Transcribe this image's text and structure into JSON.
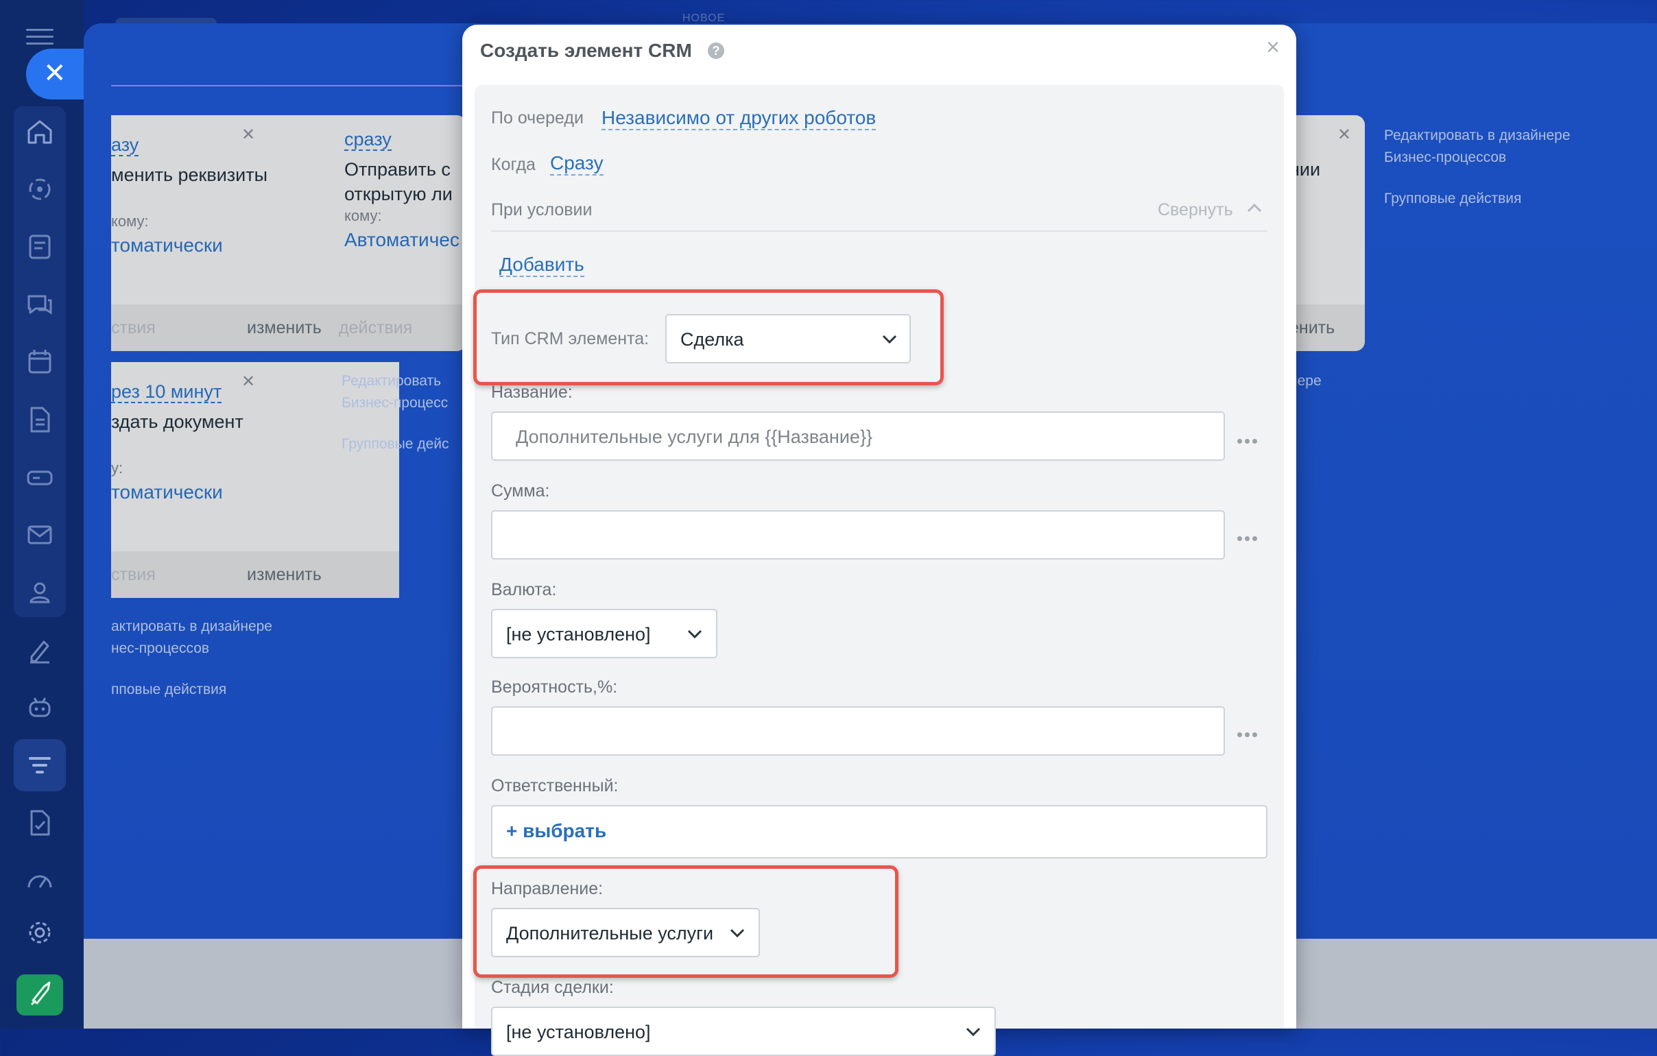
{
  "nav": {
    "icons": [
      "home-icon",
      "target-icon",
      "feed-icon",
      "chat-icon",
      "calendar-icon",
      "document-icon",
      "drive-icon",
      "mail-icon",
      "contacts-icon",
      "sign-icon",
      "bot-icon",
      "crm-funnel-icon",
      "task-doc-icon",
      "speedometer-icon",
      "gear-icon",
      "rocket-icon"
    ]
  },
  "background": {
    "top_label": "НОВОЕ",
    "card1": {
      "trigger": "азу",
      "action": "менить реквизиты",
      "to_label": "кому:",
      "to_value": "томатически",
      "foot_left": "ствия",
      "foot_right": "изменить"
    },
    "card2": {
      "trigger": "сразу",
      "action_line1": "Отправить с",
      "action_line2": "открытую ли",
      "to_label": "кому:",
      "to_value": "Автоматичес",
      "foot_left": "действия"
    },
    "card3": {
      "trigger": "рез 10 минут",
      "action": "здать документ",
      "to_label": "у:",
      "to_value": "томатически",
      "foot_left": "ствия",
      "foot_right": "изменить"
    },
    "card4": {
      "action": "нии",
      "foot_right": "енить"
    },
    "left_links": [
      "актировать в дизайнере",
      "нес-процессов",
      "пповые действия"
    ],
    "mid_links": [
      "Редактировать",
      "Бизнес-процесс",
      "Групповые дейс"
    ],
    "right_links": [
      "Редактировать в дизайнере",
      "Бизнес-процессов",
      "Групповые действия"
    ],
    "right_partial": "нере"
  },
  "modal": {
    "title": "Создать элемент CRM",
    "help": "?",
    "close": "×",
    "queue_label": "По очереди",
    "queue_value": "Независимо от других роботов",
    "when_label": "Когда",
    "when_value": "Сразу",
    "condition_label": "При условии",
    "collapse_label": "Свернуть",
    "add_label": "Добавить",
    "crm_type_label": "Тип CRM элемента:",
    "crm_type_value": "Сделка",
    "name_label": "Название:",
    "name_value": "Дополнительные услуги для {{Название}}",
    "sum_label": "Сумма:",
    "sum_value": "",
    "currency_label": "Валюта:",
    "currency_value": "[не установлено]",
    "probability_label": "Вероятность,%:",
    "probability_value": "",
    "responsible_label": "Ответственный:",
    "responsible_action": "+ выбрать",
    "direction_label": "Направление:",
    "direction_value": "Дополнительные услуги",
    "stage_label": "Стадия сделки:",
    "stage_value": "[не установлено]"
  },
  "colors": {
    "highlight": "#e5564e",
    "link": "#2a6fb9",
    "accent": "#2874f0"
  }
}
